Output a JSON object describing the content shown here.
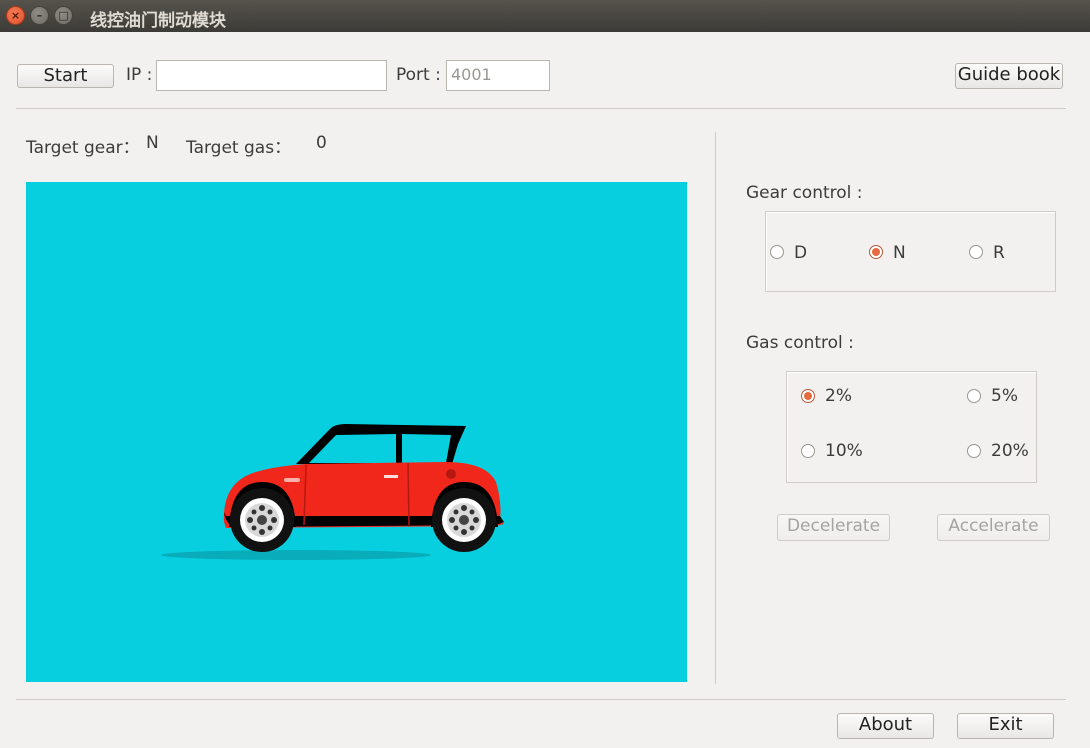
{
  "window": {
    "title": "线控油门制动模块"
  },
  "toolbar": {
    "start_label": "Start",
    "ip_label": "IP :",
    "ip_value": "",
    "port_label": "Port :",
    "port_placeholder": "4001",
    "guide_label": "Guide book"
  },
  "status": {
    "target_gear_label": "Target gear：",
    "target_gear_value": "N",
    "target_gas_label": "Target gas：",
    "target_gas_value": "0"
  },
  "gear_control": {
    "label": "Gear control :",
    "options": [
      "D",
      "N",
      "R"
    ],
    "selected": "N"
  },
  "gas_control": {
    "label": "Gas control :",
    "options": [
      "2%",
      "5%",
      "10%",
      "20%"
    ],
    "selected": "2%"
  },
  "actions": {
    "decelerate_label": "Decelerate",
    "accelerate_label": "Accelerate"
  },
  "footer": {
    "about_label": "About",
    "exit_label": "Exit"
  },
  "colors": {
    "canvas_bg": "#08cfdf",
    "car_body": "#f2271c",
    "radio_accent": "#e56a3f"
  }
}
